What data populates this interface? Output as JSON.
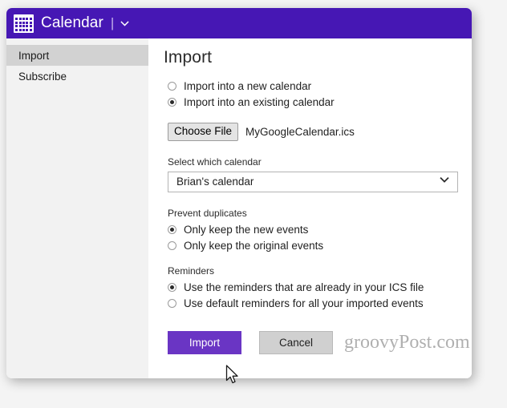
{
  "window": {
    "title": "Calendar",
    "title_separator": "|",
    "caret_icon": "chevron-down-icon",
    "app_icon": "calendar-icon"
  },
  "colors": {
    "header_purple": "#4617B4",
    "primary_button_purple": "#6A35C4",
    "sidebar_bg": "#F2F2F2",
    "sidebar_selected": "#D2D2D2"
  },
  "sidebar": {
    "items": [
      {
        "label": "Import",
        "selected": true
      },
      {
        "label": "Subscribe",
        "selected": false
      }
    ]
  },
  "main": {
    "heading": "Import",
    "target_options": [
      {
        "label": "Import into a new calendar",
        "selected": false
      },
      {
        "label": "Import into an existing calendar",
        "selected": true
      }
    ],
    "file_picker": {
      "button_label": "Choose File",
      "file_name": "MyGoogleCalendar.ics"
    },
    "calendar_field": {
      "label": "Select which calendar",
      "selected_value": "Brian's calendar",
      "caret_icon": "chevron-down-icon"
    },
    "duplicates": {
      "heading": "Prevent duplicates",
      "options": [
        {
          "label": "Only keep the new events",
          "selected": true
        },
        {
          "label": "Only keep the original events",
          "selected": false
        }
      ]
    },
    "reminders": {
      "heading": "Reminders",
      "options": [
        {
          "label": "Use the reminders that are already in your ICS file",
          "selected": true
        },
        {
          "label": "Use default reminders for all your imported events",
          "selected": false
        }
      ]
    },
    "actions": {
      "primary_label": "Import",
      "secondary_label": "Cancel"
    }
  },
  "watermark": {
    "text": "groovyPost.com"
  }
}
